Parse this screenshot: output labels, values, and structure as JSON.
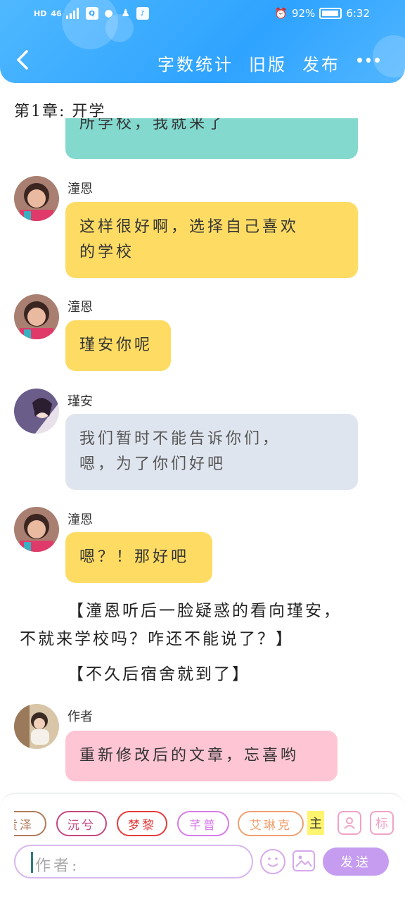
{
  "status_bar": {
    "left_badges": [
      "HD",
      "46"
    ],
    "battery": "92%",
    "time": "6:32"
  },
  "nav": {
    "actions": [
      "字数统计",
      "旧版",
      "发布"
    ],
    "back_icon": "chevron-left-icon",
    "more_icon": "more-dots-icon"
  },
  "chapter_title": "第1章: 开学",
  "messages": [
    {
      "sender": "",
      "text": "所学校，我就来了",
      "bubble": "teal"
    },
    {
      "sender": "潼恩",
      "lines": [
        "这样很好啊，选择自己喜欢",
        "的学校"
      ],
      "bubble": "yellow"
    },
    {
      "sender": "潼恩",
      "lines": [
        "瑾安你呢"
      ],
      "bubble": "yellow"
    },
    {
      "sender": "瑾安",
      "lines": [
        "我们暂时不能告诉你们，",
        "嗯，为了你们好吧"
      ],
      "bubble": "gray"
    },
    {
      "sender": "潼恩",
      "lines": [
        "嗯？！那好吧"
      ],
      "bubble": "yellow"
    },
    {
      "sender": "作者",
      "lines": [
        "重新修改后的文章，忘喜哟"
      ],
      "bubble": "pink"
    }
  ],
  "narration": [
    {
      "lines": [
        "【潼恩听后一脸疑惑的看向瑾安，",
        "不就来学校吗？咋还不能说了？】"
      ]
    },
    {
      "lines": [
        "【不久后宿舍就到了】"
      ]
    }
  ],
  "character_chips": [
    {
      "label": "贡泽",
      "color": "#b07a5a"
    },
    {
      "label": "沅兮",
      "color": "#c4477f"
    },
    {
      "label": "梦黎",
      "color": "#e23b3b"
    },
    {
      "label": "芊普",
      "color": "#d77be8"
    },
    {
      "label": "艾琳克",
      "color": "#f0a070"
    }
  ],
  "chip_main": "主",
  "right_tools": {
    "avatar_icon": "person-card-icon",
    "mark_label": "标"
  },
  "input": {
    "placeholder": "作者:"
  },
  "send_label": "发送",
  "colors": {
    "header": "#2ea3ff",
    "yellow": "#fedc64",
    "gray": "#dfe5ee",
    "pink": "#fec5d4",
    "teal": "#84d9cf",
    "send": "#c59cf0"
  }
}
